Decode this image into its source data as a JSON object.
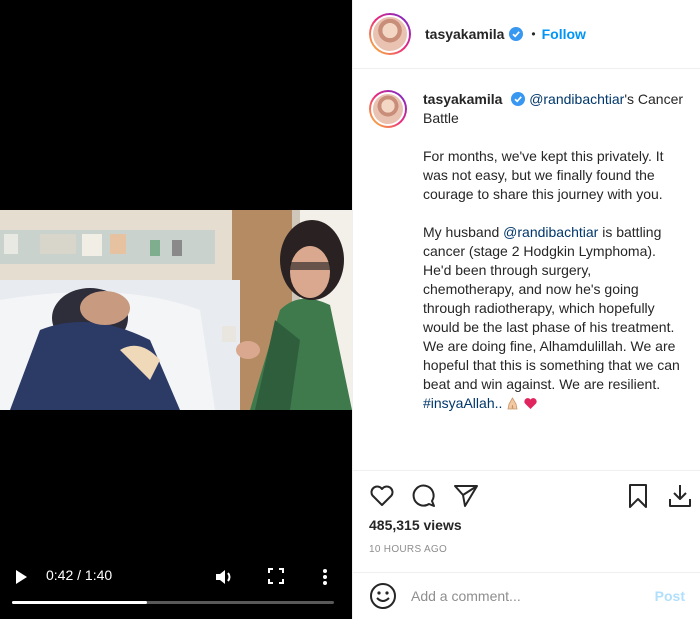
{
  "video": {
    "time": "0:42 / 1:40",
    "progress": 0.42
  },
  "header": {
    "username": "tasyakamila",
    "dot": "•",
    "follow_label": "Follow"
  },
  "caption": {
    "username": "tasyakamila",
    "line1_mention": "@randibachtiar",
    "line1_rest": "'s Cancer Battle",
    "para1": "For months, we've kept this privately. It was not easy, but we finally found the courage to share this journey with you.",
    "para2_a": "My husband ",
    "para2_mention": "@randibachtiar",
    "para2_b": " is battling cancer (stage 2 Hodgkin Lymphoma). He'd been through surgery, chemotherapy, and now he's going through radiotherapy, which hopefully would be the last phase of his treatment. We are doing fine, Alhamdulillah. We are hopeful that this is something that we can beat and win against. We are resilient. ",
    "hashtag": "#insyaAllah.."
  },
  "stats": {
    "views": "485,315 views",
    "time_ago": "10 HOURS AGO"
  },
  "comment": {
    "placeholder": "Add a comment...",
    "post_label": "Post"
  },
  "colors": {
    "accent": "#0095f6",
    "link": "#00376b",
    "muted": "#8e8e8e"
  }
}
